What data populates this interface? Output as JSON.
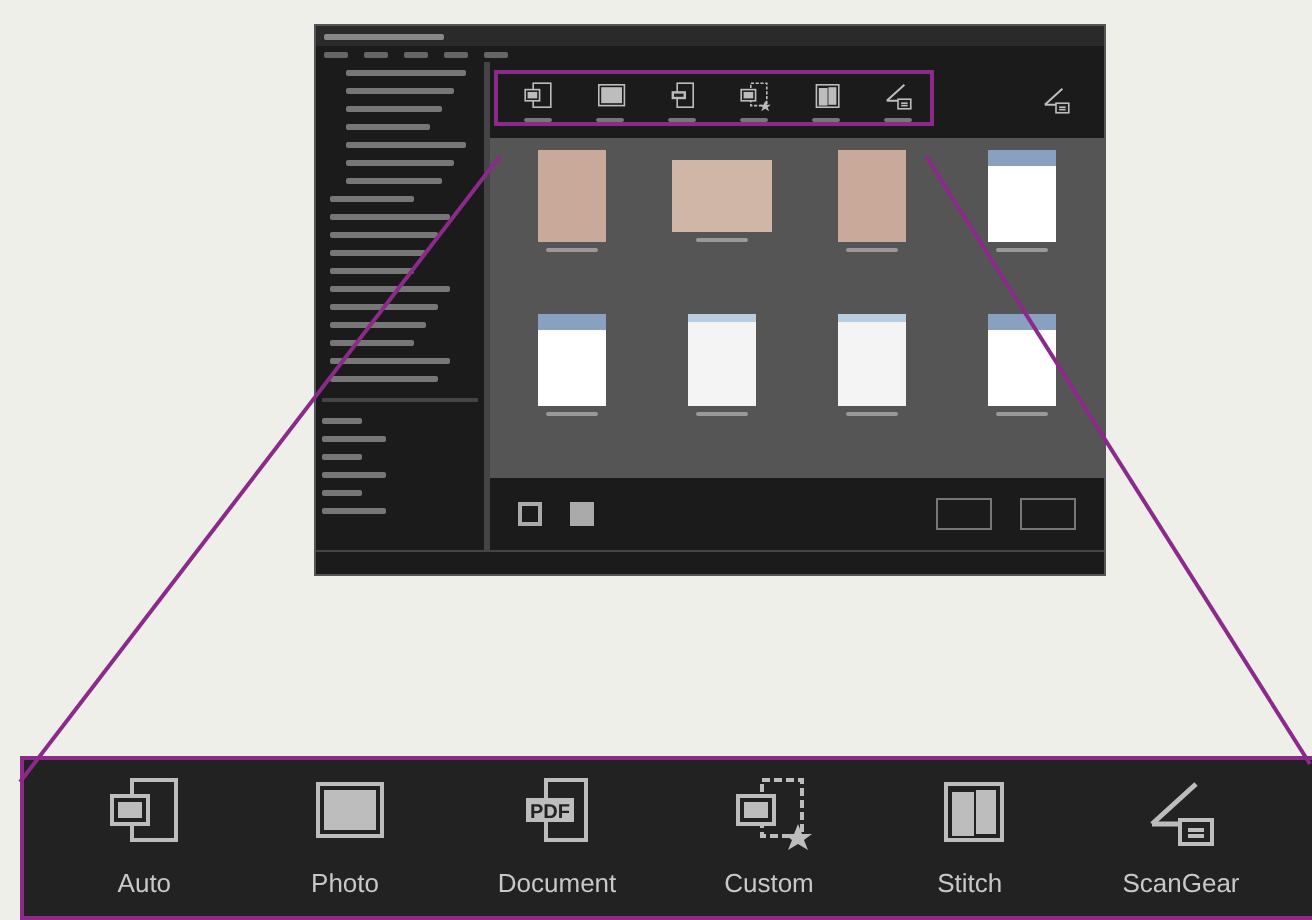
{
  "window_preview": {
    "toolbar_buttons": [
      {
        "kind": "auto"
      },
      {
        "kind": "photo"
      },
      {
        "kind": "document"
      },
      {
        "kind": "custom"
      },
      {
        "kind": "stitch"
      },
      {
        "kind": "scangear"
      }
    ],
    "thumbnails": [
      {
        "kind": "photo"
      },
      {
        "kind": "photo-wide"
      },
      {
        "kind": "photo"
      },
      {
        "kind": "document"
      },
      {
        "kind": "document"
      },
      {
        "kind": "document-light"
      },
      {
        "kind": "document-light"
      },
      {
        "kind": "document"
      }
    ]
  },
  "zoomed_toolbar": {
    "buttons": [
      {
        "label": "Auto",
        "kind": "auto"
      },
      {
        "label": "Photo",
        "kind": "photo"
      },
      {
        "label": "Document",
        "kind": "document",
        "icon_text": "PDF"
      },
      {
        "label": "Custom",
        "kind": "custom"
      },
      {
        "label": "Stitch",
        "kind": "stitch"
      },
      {
        "label": "ScanGear",
        "kind": "scangear"
      }
    ]
  }
}
